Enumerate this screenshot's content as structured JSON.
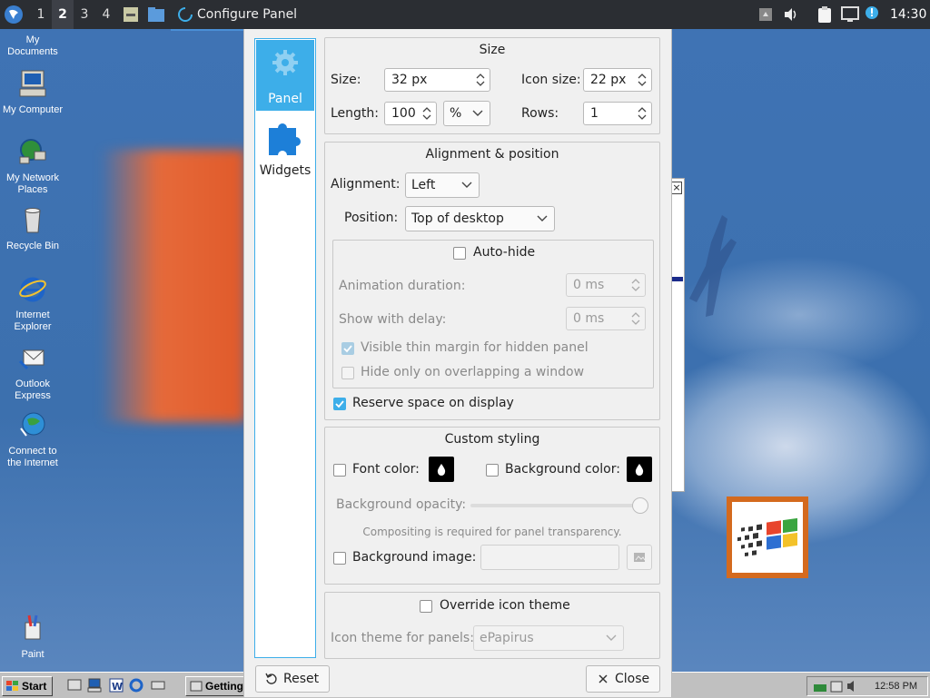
{
  "top_panel": {
    "workspaces": [
      "1",
      "2",
      "3",
      "4"
    ],
    "active_workspace": "2",
    "task_title": "Configure Panel",
    "clock": "14:30"
  },
  "desktop_icons": [
    {
      "label_lines": [
        "My Documents"
      ]
    },
    {
      "label_lines": [
        "My Computer"
      ]
    },
    {
      "label_lines": [
        "My Network",
        "Places"
      ]
    },
    {
      "label_lines": [
        "Recycle Bin"
      ]
    },
    {
      "label_lines": [
        "Internet",
        "Explorer"
      ]
    },
    {
      "label_lines": [
        "Outlook",
        "Express"
      ]
    },
    {
      "label_lines": [
        "Connect to",
        "the Internet"
      ]
    },
    {
      "label_lines": [
        "Paint"
      ]
    }
  ],
  "taskbar98": {
    "start_label": "Start",
    "task_label": "Getting",
    "clock": "12:58 PM"
  },
  "dialog": {
    "sidebar": {
      "panel_label": "Panel",
      "widgets_label": "Widgets"
    },
    "size_group": {
      "title": "Size",
      "size_label": "Size:",
      "size_value": "32 px",
      "icon_size_label": "Icon size:",
      "icon_size_value": "22 px",
      "length_label": "Length:",
      "length_value": "100",
      "length_unit": "%",
      "rows_label": "Rows:",
      "rows_value": "1"
    },
    "alignment_group": {
      "title": "Alignment & position",
      "alignment_label": "Alignment:",
      "alignment_value": "Left",
      "position_label": "Position:",
      "position_value": "Top of desktop",
      "autohide_label": "Auto-hide",
      "autohide_checked": false,
      "anim_label": "Animation duration:",
      "anim_value": "0 ms",
      "delay_label": "Show with delay:",
      "delay_value": "0 ms",
      "thin_margin_label": "Visible thin margin for hidden panel",
      "thin_margin_checked": true,
      "overlap_label": "Hide only on overlapping a window",
      "overlap_checked": false,
      "reserve_label": "Reserve space on display",
      "reserve_checked": true
    },
    "styling_group": {
      "title": "Custom styling",
      "font_color_label": "Font color:",
      "bg_color_label": "Background color:",
      "opacity_label": "Background opacity:",
      "opacity_value": 1.0,
      "compositing_note": "Compositing is required for panel transparency.",
      "bg_image_label": "Background image:",
      "bg_image_value": ""
    },
    "icon_theme_group": {
      "override_label": "Override icon theme",
      "override_checked": false,
      "theme_label": "Icon theme for panels:",
      "theme_value": "ePapirus"
    },
    "reset_label": "Reset",
    "close_label": "Close"
  },
  "colors": {
    "accent": "#3daee9",
    "desktop_blue": "#3c70ae",
    "top_panel": "#2b2e33"
  }
}
